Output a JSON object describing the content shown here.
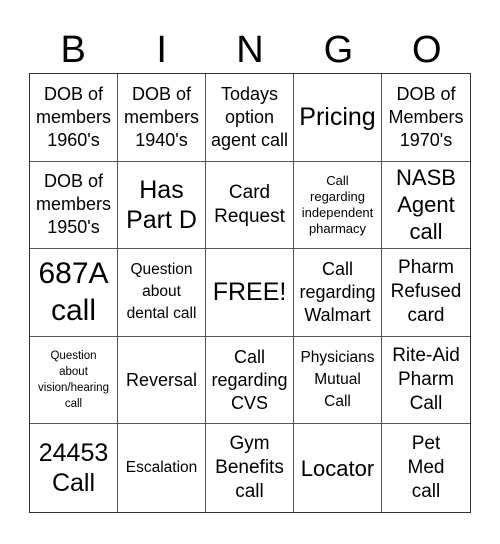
{
  "header": {
    "letters": [
      "B",
      "I",
      "N",
      "G",
      "O"
    ]
  },
  "cells": [
    {
      "text": "DOB of\nmembers\n1960's"
    },
    {
      "text": "DOB of\nmembers\n1940's"
    },
    {
      "text": "Todays\noption\nagent call"
    },
    {
      "text": "Pricing"
    },
    {
      "text": "DOB of\nMembers\n1970's"
    },
    {
      "text": "DOB of\nmembers\n1950's"
    },
    {
      "text": "Has\nPart D"
    },
    {
      "text": "Card\nRequest"
    },
    {
      "text": "Call\nregarding\nindependent\npharmacy"
    },
    {
      "text": "NASB\nAgent\ncall"
    },
    {
      "text": "687A\ncall"
    },
    {
      "text": "Question\nabout\ndental call"
    },
    {
      "text": "FREE!"
    },
    {
      "text": "Call\nregarding\nWalmart"
    },
    {
      "text": "Pharm\nRefused\ncard"
    },
    {
      "text": "Question\nabout\nvision/hearing\ncall"
    },
    {
      "text": "Reversal"
    },
    {
      "text": "Call\nregarding\nCVS"
    },
    {
      "text": "Physicians\nMutual\nCall"
    },
    {
      "text": "Rite-Aid\nPharm\nCall"
    },
    {
      "text": "24453\nCall"
    },
    {
      "text": "Escalation"
    },
    {
      "text": "Gym\nBenefits\ncall"
    },
    {
      "text": "Locator"
    },
    {
      "text": "Pet\nMed\ncall"
    }
  ]
}
